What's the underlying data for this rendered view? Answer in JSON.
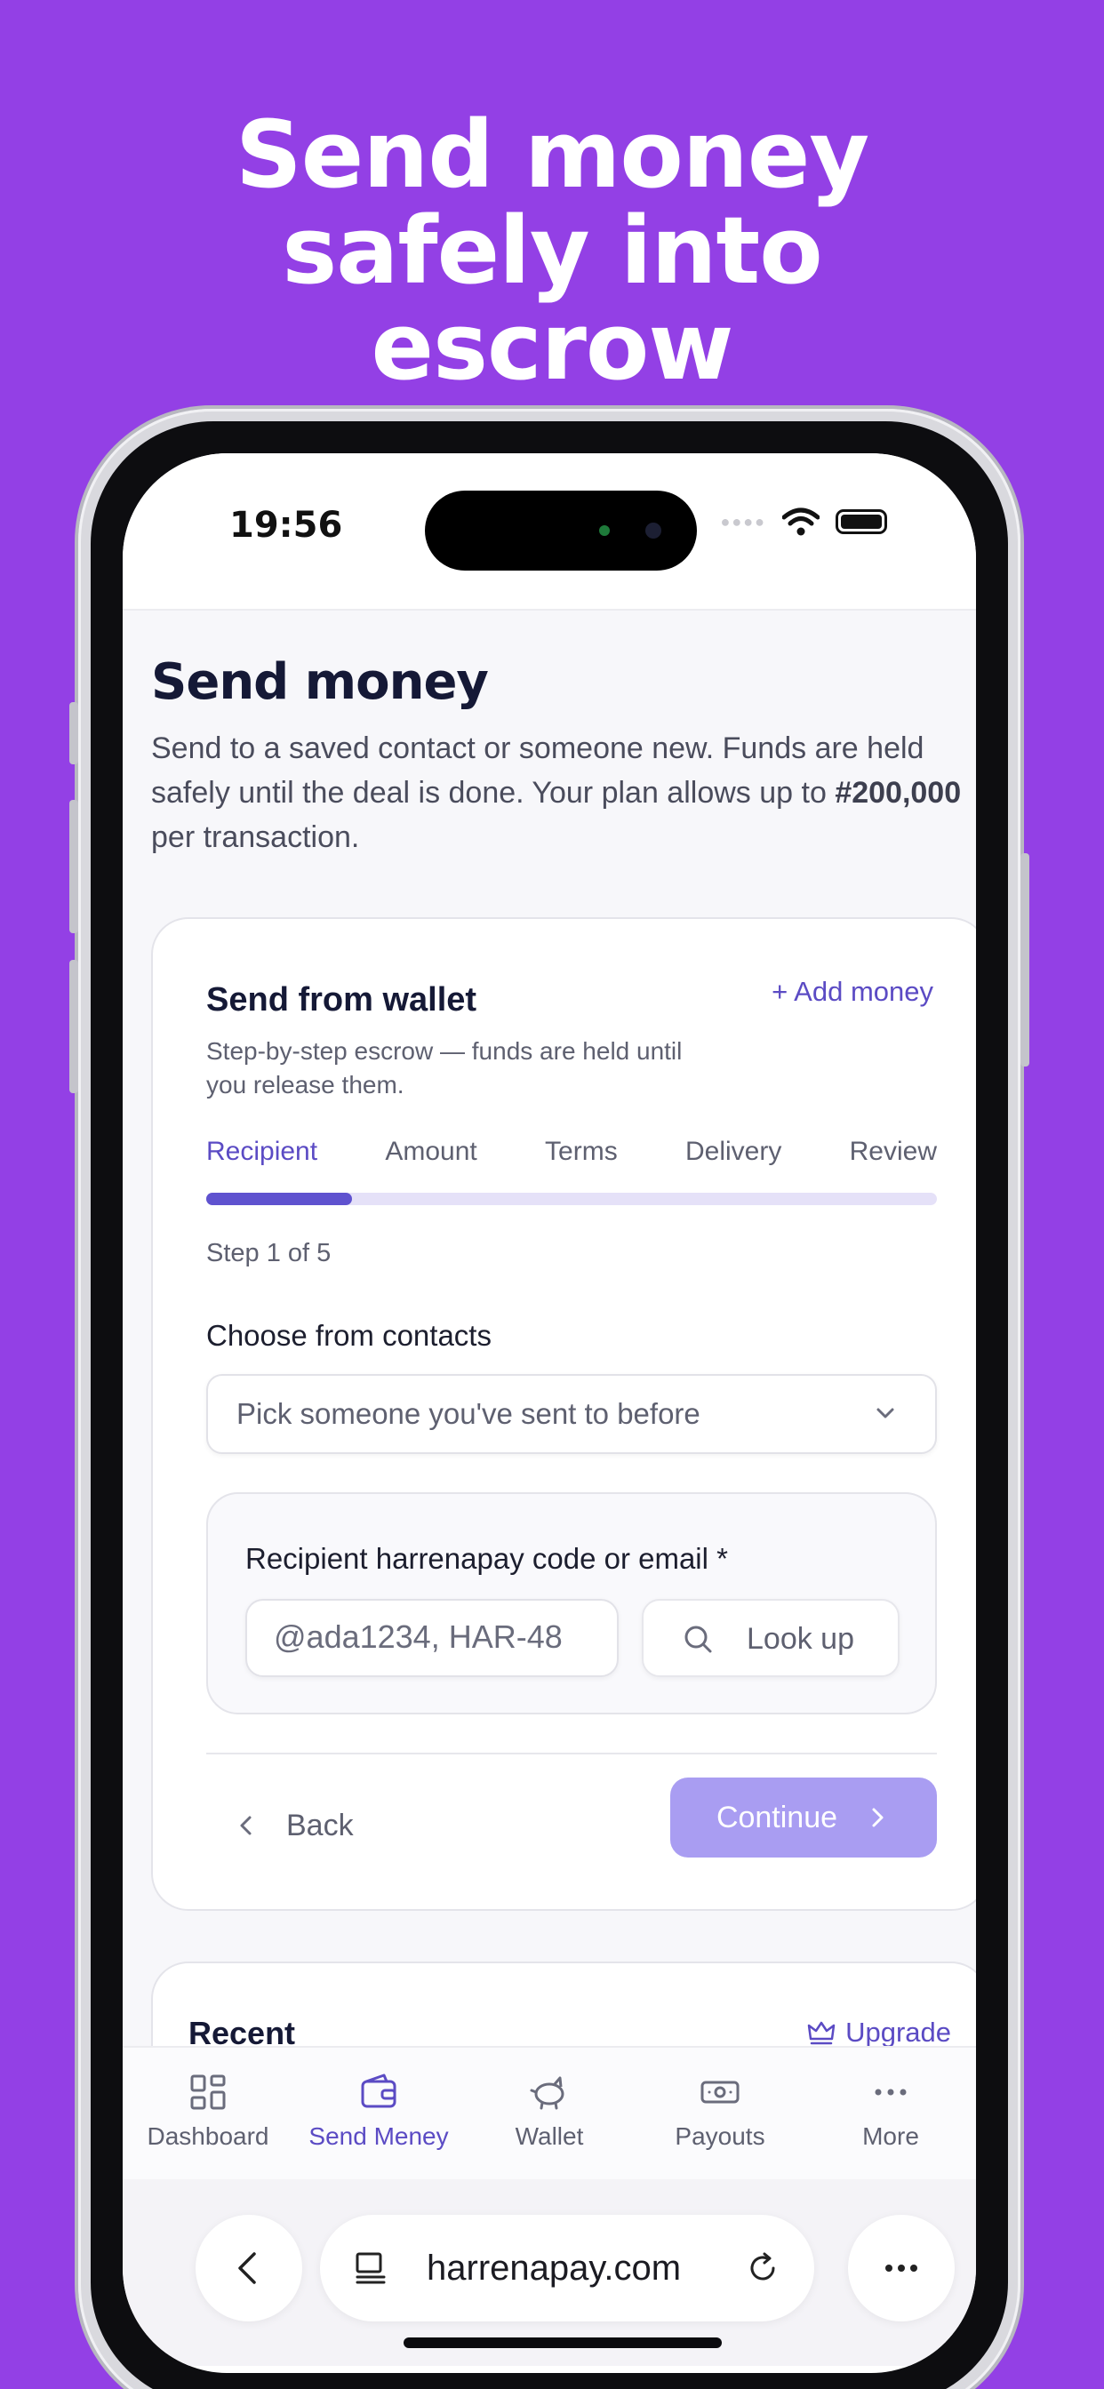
{
  "headline": {
    "line1": "Send money",
    "line2": "safely into",
    "line3": "escrow"
  },
  "status_bar": {
    "time": "19:56"
  },
  "page": {
    "title": "Send money",
    "description_start": "Send to a saved contact or someone new. Funds are held safely until the deal is done. Your plan allows up to ",
    "limit": "#200,000",
    "description_end": " per transaction."
  },
  "wallet_card": {
    "title": "Send from wallet",
    "add_money": "+ Add money",
    "subtitle": "Step-by-step escrow — funds are held until you release them.",
    "steps": [
      "Recipient",
      "Amount",
      "Terms",
      "Delivery",
      "Review"
    ],
    "active_step": 0,
    "progress_fraction": 0.2,
    "step_count": "Step 1 of 5",
    "contacts_label": "Choose from contacts",
    "contacts_placeholder": "Pick someone you've sent to before",
    "recipient_label": "Recipient harrenapay code or email *",
    "recipient_placeholder": "@ada1234, HAR-48",
    "lookup_label": "Look up",
    "back_label": "Back",
    "continue_label": "Continue"
  },
  "recent_card": {
    "title": "Recent",
    "upgrade_label": "Upgrade"
  },
  "bottom_nav": {
    "items": [
      {
        "label": "Dashboard",
        "icon": "grid-icon"
      },
      {
        "label": "Send Meney",
        "icon": "wallet-icon"
      },
      {
        "label": "Wallet",
        "icon": "piggy-bank-icon"
      },
      {
        "label": "Payouts",
        "icon": "cash-icon"
      },
      {
        "label": "More",
        "icon": "more-dots-icon"
      }
    ],
    "active_index": 1
  },
  "browser": {
    "url": "harrenapay.com"
  },
  "colors": {
    "background": "#9340E5",
    "accent": "#5B4BC4",
    "continue_disabled": "#A99DF2"
  }
}
